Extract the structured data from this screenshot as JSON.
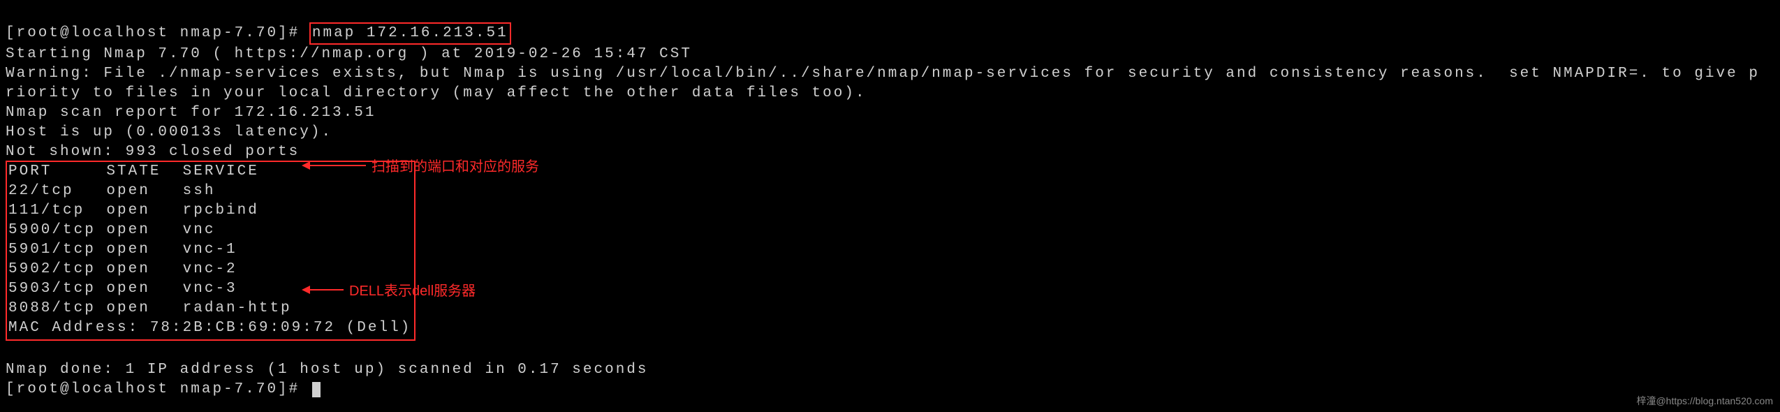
{
  "prompt1": "[root@localhost nmap-7.70]# ",
  "command": "nmap 172.16.213.51",
  "line_start": "Starting Nmap 7.70 ( https://nmap.org ) at 2019-02-26 15:47 CST",
  "line_warn": "Warning: File ./nmap-services exists, but Nmap is using /usr/local/bin/../share/nmap/nmap-services for security and consistency reasons.  set NMAPDIR=. to give priority to files in your local directory (may affect the other data files too).",
  "line_report": "Nmap scan report for 172.16.213.51",
  "line_host": "Host is up (0.00013s latency).",
  "line_notshown": "Not shown: 993 closed ports",
  "ports_header": "PORT     STATE  SERVICE",
  "ports": [
    "22/tcp   open   ssh",
    "111/tcp  open   rpcbind",
    "5900/tcp open   vnc",
    "5901/tcp open   vnc-1",
    "5902/tcp open   vnc-2",
    "5903/tcp open   vnc-3",
    "8088/tcp open   radan-http"
  ],
  "mac_line": "MAC Address: 78:2B:CB:69:09:72 (Dell)",
  "blank": "",
  "line_done": "Nmap done: 1 IP address (1 host up) scanned in 0.17 seconds",
  "prompt2": "[root@localhost nmap-7.70]# ",
  "annotation_ports": "扫描到的端口和对应的服务",
  "annotation_mac": "DELL表示dell服务器",
  "watermark": "梓潼@https://blog.ntan520.com"
}
